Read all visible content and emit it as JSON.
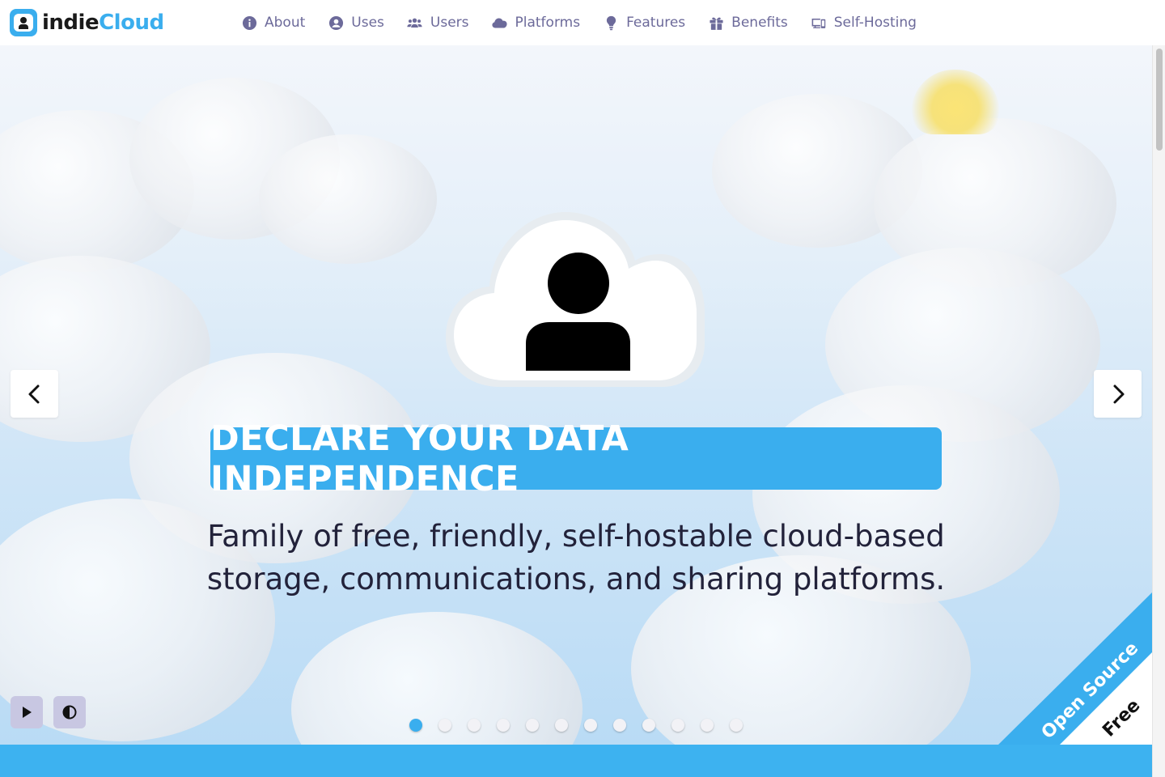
{
  "brand": {
    "name_part1": "indie",
    "name_part2": "Cloud",
    "accent_color": "#3aaeee"
  },
  "nav": {
    "items": [
      {
        "label": "About",
        "icon": "info-circle-icon"
      },
      {
        "label": "Uses",
        "icon": "user-circle-icon"
      },
      {
        "label": "Users",
        "icon": "users-icon"
      },
      {
        "label": "Platforms",
        "icon": "cloud-icon"
      },
      {
        "label": "Features",
        "icon": "lightbulb-icon"
      },
      {
        "label": "Benefits",
        "icon": "gift-icon"
      },
      {
        "label": "Self-Hosting",
        "icon": "devices-icon"
      }
    ],
    "text_color": "#6c6a9a"
  },
  "hero": {
    "headline": "DECLARE YOUR DATA INDEPENDENCE",
    "subtitle_line1": "Family of free, friendly, self-hostable cloud-based",
    "subtitle_line2": "storage, communications, and sharing platforms.",
    "slide_count": 12,
    "active_slide": 1
  },
  "ribbon": {
    "label_top": "Open Source",
    "label_bottom": "Free",
    "color": "#3aaeee"
  },
  "controls": {
    "prev_icon": "chevron-left-icon",
    "next_icon": "chevron-right-icon",
    "play_icon": "play-icon",
    "contrast_icon": "contrast-icon"
  }
}
